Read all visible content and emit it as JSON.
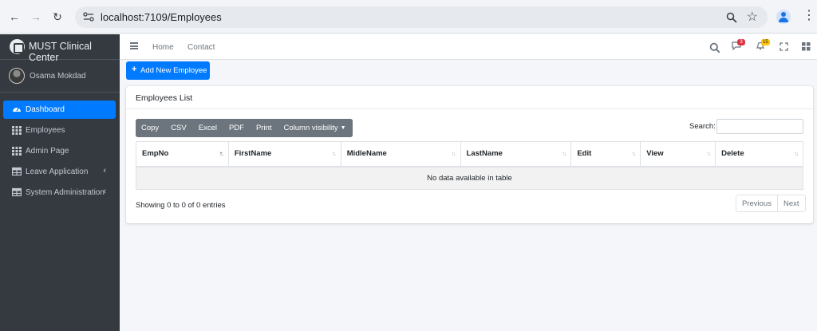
{
  "browser": {
    "url": "localhost:7109/Employees"
  },
  "sidebar": {
    "brand": "MUST Clinical Center",
    "user": "Osama Mokdad",
    "items": [
      {
        "label": "Dashboard",
        "icon": "tachometer-icon",
        "active": true,
        "has_children": false
      },
      {
        "label": "Employees",
        "icon": "grid-icon",
        "active": false,
        "has_children": false
      },
      {
        "label": "Admin Page",
        "icon": "grid-icon",
        "active": false,
        "has_children": false
      },
      {
        "label": "Leave Application",
        "icon": "table-icon",
        "active": false,
        "has_children": true
      },
      {
        "label": "System Administration",
        "icon": "table-icon",
        "active": false,
        "has_children": true
      }
    ]
  },
  "topbar": {
    "links": [
      "Home",
      "Contact"
    ],
    "messages_badge": "3",
    "notifications_badge": "15"
  },
  "main": {
    "add_button": "Add New Employee",
    "card_title": "Employees List",
    "export_buttons": [
      "Copy",
      "CSV",
      "Excel",
      "PDF",
      "Print",
      "Column visibility"
    ],
    "search_label": "Search:",
    "search_value": "",
    "columns": [
      "EmpNo",
      "FirstName",
      "MidleName",
      "LastName",
      "Edit",
      "View",
      "Delete"
    ],
    "empty_message": "No data available in table",
    "info": "Showing 0 to 0 of 0 entries",
    "pager": {
      "previous": "Previous",
      "next": "Next"
    }
  },
  "colors": {
    "primary": "#007bff",
    "sidebar_bg": "#343a40",
    "danger": "#dc3545",
    "warning": "#ffc107"
  }
}
